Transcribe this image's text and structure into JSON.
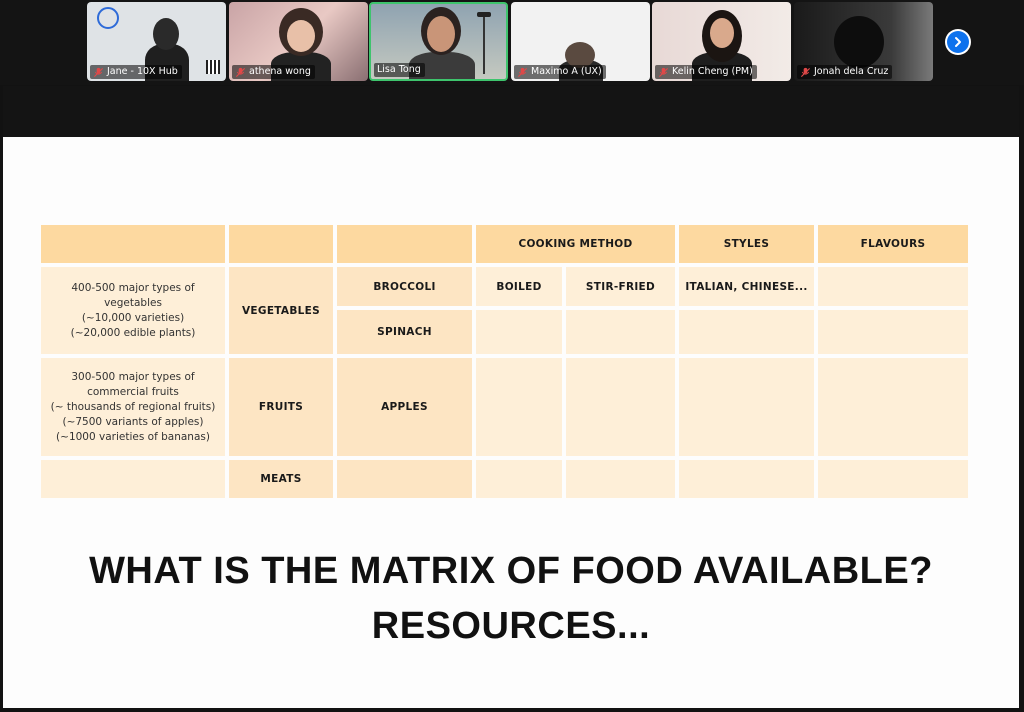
{
  "participants": [
    {
      "name": "Jane - 10X Hub",
      "muted": true
    },
    {
      "name": "athena wong",
      "muted": true
    },
    {
      "name": "Lisa Tong",
      "muted": false,
      "active": true
    },
    {
      "name": "Maximo A (UX)",
      "muted": true
    },
    {
      "name": "Kelin Cheng (PM)",
      "muted": true
    },
    {
      "name": "Jonah dela Cruz",
      "muted": true
    }
  ],
  "next_icon": "chevron-right-icon",
  "table": {
    "headers": {
      "cooking_method": "COOKING METHOD",
      "styles": "STYLES",
      "flavours": "FLAVOURS"
    },
    "rows": {
      "vegetables": {
        "desc": "400-500 major types of vegetables\n(~10,000 varieties)\n(~20,000 edible plants)",
        "category": "VEGETABLES",
        "items": [
          "BROCCOLI",
          "SPINACH"
        ],
        "methods": [
          "BOILED",
          "STIR-FRIED"
        ],
        "styles": "ITALIAN, CHINESE..."
      },
      "fruits": {
        "desc": "300-500 major types of commercial fruits\n(~ thousands of regional fruits)\n(~7500 variants of apples)\n(~1000 varieties of bananas)",
        "category": "FRUITS",
        "item": "APPLES"
      },
      "meats": {
        "category": "MEATS"
      }
    }
  },
  "slide_title": {
    "line1": "WHAT IS THE MATRIX OF FOOD AVAILABLE?",
    "line2": "RESOURCES..."
  },
  "colors": {
    "header": "#fdd9a0",
    "cell_light": "#feefd8",
    "cell_mid": "#fde5c3",
    "active_border": "#3ec46d",
    "accent": "#0e72ed"
  }
}
